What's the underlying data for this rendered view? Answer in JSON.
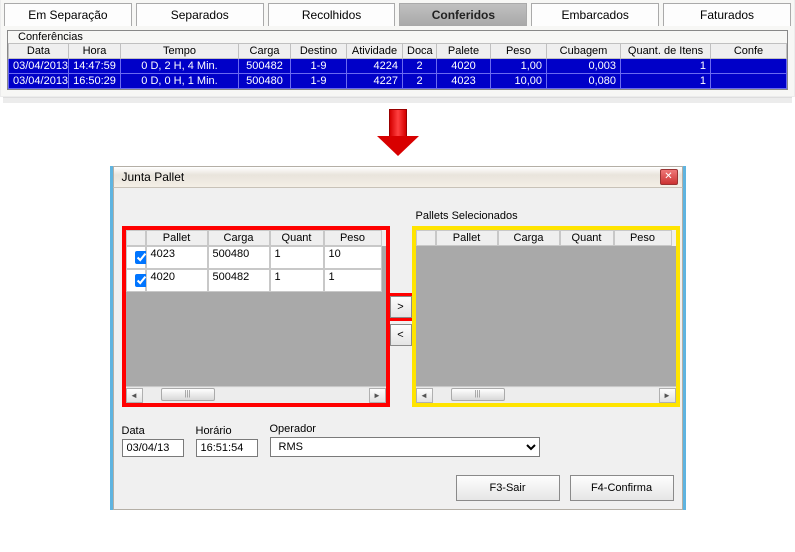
{
  "tabs": [
    "Em Separação",
    "Separados",
    "Recolhidos",
    "Conferidos",
    "Embarcados",
    "Faturados"
  ],
  "active_tab": 3,
  "group_title": "Conferências",
  "grid_headers": [
    "Data",
    "Hora",
    "Tempo",
    "Carga",
    "Destino",
    "Atividade",
    "Doca",
    "Palete",
    "Peso",
    "Cubagem",
    "Quant. de Itens",
    "Confe"
  ],
  "grid_rows": [
    {
      "data": "03/04/2013",
      "hora": "14:47:59",
      "tempo": "0 D, 2 H, 4 Min.",
      "carga": "500482",
      "destino": "1-9",
      "atividade": "4224",
      "doca": "2",
      "palete": "4020",
      "peso": "1,00",
      "cubagem": "0,003",
      "qtd": "1"
    },
    {
      "data": "03/04/2013",
      "hora": "16:50:29",
      "tempo": "0 D, 0 H, 1 Min.",
      "carga": "500480",
      "destino": "1-9",
      "atividade": "4227",
      "doca": "2",
      "palete": "4023",
      "peso": "10,00",
      "cubagem": "0,080",
      "qtd": "1"
    }
  ],
  "dialog": {
    "title": "Junta Pallet",
    "left_headers_blank": "",
    "list_headers": [
      "Pallet",
      "Carga",
      "Quant",
      "Peso"
    ],
    "left_rows": [
      {
        "checked": true,
        "pallet": "4023",
        "carga": "500480",
        "quant": "1",
        "peso": "10"
      },
      {
        "checked": true,
        "pallet": "4020",
        "carga": "500482",
        "quant": "1",
        "peso": "1"
      }
    ],
    "selected_legend": "Pallets Selecionados",
    "move_right": ">",
    "move_left": "<",
    "fields": {
      "data_label": "Data",
      "data_value": "03/04/13",
      "hora_label": "Horário",
      "hora_value": "16:51:54",
      "oper_label": "Operador",
      "oper_value": "RMS"
    },
    "btn_exit": "F3-Sair",
    "btn_confirm": "F4-Confirma",
    "scroll_mark": "|||"
  }
}
